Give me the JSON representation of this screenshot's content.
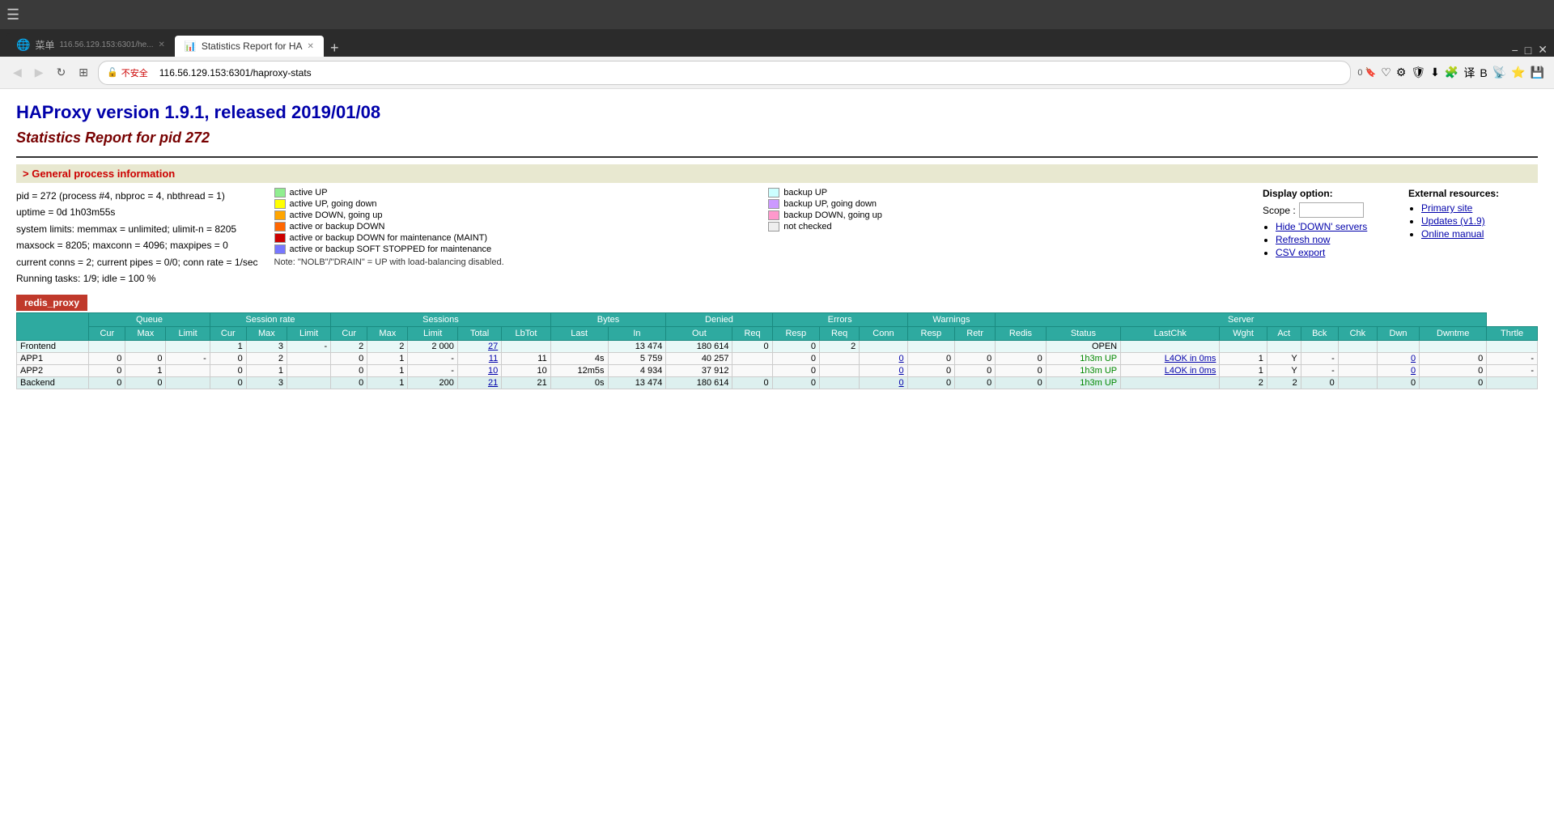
{
  "browser": {
    "tabs": [
      {
        "id": "tab1",
        "title": "菜单",
        "url": "116.56.129.153:6301/he...",
        "active": false
      },
      {
        "id": "tab2",
        "title": "Statistics Report for HA",
        "url": "116.56.129.153:6301/haproxy-stats",
        "active": true
      }
    ],
    "address": "116.56.129.153:6301/haproxy-stats",
    "security_label": "不安全"
  },
  "page": {
    "title": "HAProxy version 1.9.1, released 2019/01/08",
    "subtitle": "Statistics Report for pid 272"
  },
  "general_info": {
    "header": "> General process information",
    "pid_line": "pid = 272 (process #4, nbproc = 4, nbthread = 1)",
    "uptime_line": "uptime = 0d 1h03m55s",
    "system_limits_line": "system limits: memmax = unlimited; ulimit-n = 8205",
    "maxsock_line": "maxsock = 8205; maxconn = 4096; maxpipes = 0",
    "conns_line": "current conns = 2; current pipes = 0/0; conn rate = 1/sec",
    "tasks_line": "Running tasks: 1/9; idle = 100 %"
  },
  "legend": {
    "items_left": [
      {
        "color": "#90ee90",
        "label": "active UP"
      },
      {
        "color": "#ffff00",
        "label": "active UP, going down"
      },
      {
        "color": "#ffa500",
        "label": "active DOWN, going up"
      },
      {
        "color": "#ff6600",
        "label": "active or backup DOWN"
      },
      {
        "color": "#cc0000",
        "label": "active or backup DOWN for maintenance (MAINT)"
      },
      {
        "color": "#7777ff",
        "label": "active or backup SOFT STOPPED for maintenance"
      }
    ],
    "items_right": [
      {
        "color": "#ccffff",
        "label": "backup UP"
      },
      {
        "color": "#cc99ff",
        "label": "backup UP, going down"
      },
      {
        "color": "#ff99cc",
        "label": "backup DOWN, going up"
      },
      {
        "color": "#eeeeee",
        "label": "not checked"
      }
    ],
    "note": "Note: \"NOLB\"/\"DRAIN\" = UP with load-balancing disabled."
  },
  "display_options": {
    "title": "Display option:",
    "scope_label": "Scope :",
    "links": [
      {
        "label": "Hide 'DOWN' servers"
      },
      {
        "label": "Refresh now"
      },
      {
        "label": "CSV export"
      }
    ]
  },
  "external_resources": {
    "title": "External resources:",
    "links": [
      {
        "label": "Primary site"
      },
      {
        "label": "Updates (v1.9)"
      },
      {
        "label": "Online manual"
      }
    ]
  },
  "proxy": {
    "name": "redis_proxy",
    "table": {
      "col_groups": [
        "Queue",
        "Session rate",
        "Sessions",
        "Bytes",
        "Denied",
        "Errors",
        "Warnings",
        "Server"
      ],
      "sub_headers": [
        "Cur",
        "Max",
        "Limit",
        "Cur",
        "Max",
        "Limit",
        "Cur",
        "Max",
        "Limit",
        "Total",
        "LbTot",
        "Last",
        "In",
        "Out",
        "Req",
        "Resp",
        "Req",
        "Conn",
        "Resp",
        "Retr",
        "Redis",
        "Status",
        "LastChk",
        "Wght",
        "Act",
        "Bck",
        "Chk",
        "Dwn",
        "Dwntme",
        "Thrtle"
      ],
      "rows": [
        {
          "name": "Frontend",
          "type": "frontend",
          "queue_cur": "",
          "queue_max": "",
          "queue_limit": "",
          "sr_cur": "1",
          "sr_max": "3",
          "sr_limit": "-",
          "s_cur": "2",
          "s_max": "2",
          "s_limit": "2 000",
          "s_total": "27",
          "s_lbtot": "",
          "s_last": "",
          "b_in": "13 474",
          "b_out": "180 614",
          "d_req": "0",
          "d_resp": "0",
          "e_req": "2",
          "e_conn": "",
          "e_resp": "",
          "w_retr": "",
          "w_redis": "",
          "status": "OPEN",
          "lastchk": "",
          "wght": "",
          "act": "",
          "bck": "",
          "chk": "",
          "dwn": "",
          "dwntme": "",
          "thrtle": ""
        },
        {
          "name": "APP1",
          "type": "server",
          "queue_cur": "0",
          "queue_max": "0",
          "queue_limit": "-",
          "sr_cur": "0",
          "sr_max": "2",
          "sr_limit": "",
          "s_cur": "0",
          "s_max": "1",
          "s_limit": "-",
          "s_total": "11",
          "s_lbtot": "11",
          "s_last": "4s",
          "b_in": "5 759",
          "b_out": "40 257",
          "d_req": "",
          "d_resp": "0",
          "e_req": "",
          "e_conn": "0",
          "e_resp": "0",
          "w_retr": "0",
          "w_redis": "0",
          "status": "1h3m UP",
          "lastchk": "L4OK in 0ms",
          "wght": "1",
          "act": "Y",
          "bck": "-",
          "chk": "",
          "dwn": "0",
          "dwntme": "0",
          "thrtle": "-"
        },
        {
          "name": "APP2",
          "type": "server",
          "queue_cur": "0",
          "queue_max": "1",
          "queue_limit": "",
          "sr_cur": "0",
          "sr_max": "1",
          "sr_limit": "",
          "s_cur": "0",
          "s_max": "1",
          "s_limit": "-",
          "s_total": "10",
          "s_lbtot": "10",
          "s_last": "12m5s",
          "b_in": "4 934",
          "b_out": "37 912",
          "d_req": "",
          "d_resp": "0",
          "e_req": "",
          "e_conn": "0",
          "e_resp": "0",
          "w_retr": "0",
          "w_redis": "0",
          "status": "1h3m UP",
          "lastchk": "L4OK in 0ms",
          "wght": "1",
          "act": "Y",
          "bck": "-",
          "chk": "",
          "dwn": "0",
          "dwntme": "0",
          "thrtle": "-"
        },
        {
          "name": "Backend",
          "type": "backend",
          "queue_cur": "0",
          "queue_max": "0",
          "queue_limit": "",
          "sr_cur": "0",
          "sr_max": "3",
          "sr_limit": "",
          "s_cur": "0",
          "s_max": "1",
          "s_limit": "200",
          "s_total": "21",
          "s_lbtot": "21",
          "s_last": "0s",
          "b_in": "13 474",
          "b_out": "180 614",
          "d_req": "0",
          "d_resp": "0",
          "e_req": "",
          "e_conn": "0",
          "e_resp": "0",
          "w_retr": "0",
          "w_redis": "0",
          "status": "1h3m UP",
          "lastchk": "",
          "wght": "2",
          "act": "2",
          "bck": "0",
          "chk": "",
          "dwn": "0",
          "dwntme": "0",
          "thrtle": ""
        }
      ]
    }
  }
}
